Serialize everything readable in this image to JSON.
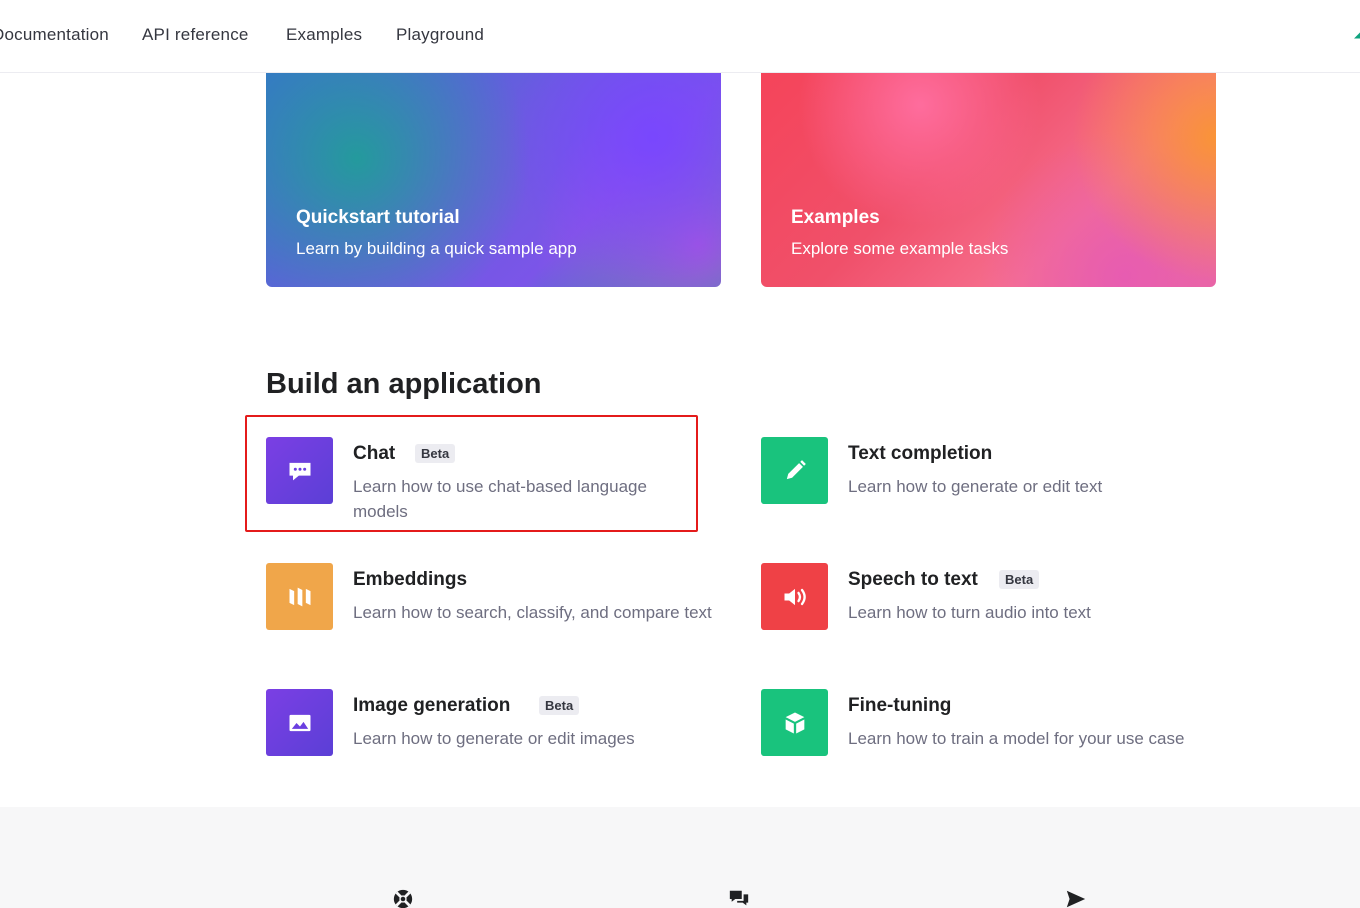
{
  "nav": {
    "items": [
      "Documentation",
      "API reference",
      "Examples",
      "Playground"
    ]
  },
  "hero": [
    {
      "title": "Quickstart tutorial",
      "description": "Learn by building a quick sample app"
    },
    {
      "title": "Examples",
      "description": "Explore some example tasks"
    }
  ],
  "section": {
    "title": "Build an application"
  },
  "apps": [
    {
      "title": "Chat",
      "badge": "Beta",
      "description": "Learn how to use chat-based language models",
      "icon": "chat-bubble-icon",
      "color": "#6b3fe0"
    },
    {
      "title": "Text completion",
      "badge": "",
      "description": "Learn how to generate or edit text",
      "icon": "pencil-icon",
      "color": "#19c37d"
    },
    {
      "title": "Embeddings",
      "badge": "",
      "description": "Learn how to search, classify, and compare text",
      "icon": "columns-icon",
      "color": "#f0a64a"
    },
    {
      "title": "Speech to text",
      "badge": "Beta",
      "description": "Learn how to turn audio into text",
      "icon": "speaker-icon",
      "color": "#ef4146"
    },
    {
      "title": "Image generation",
      "badge": "Beta",
      "description": "Learn how to generate or edit images",
      "icon": "image-icon",
      "color": "#6b3fe0"
    },
    {
      "title": "Fine-tuning",
      "badge": "",
      "description": "Learn how to train a model for your use case",
      "icon": "cube-icon",
      "color": "#19c37d"
    }
  ],
  "footer": {
    "icons": [
      "lifebuoy-icon",
      "chat-icon",
      "send-icon"
    ]
  },
  "highlight_color": "#e41b1b"
}
